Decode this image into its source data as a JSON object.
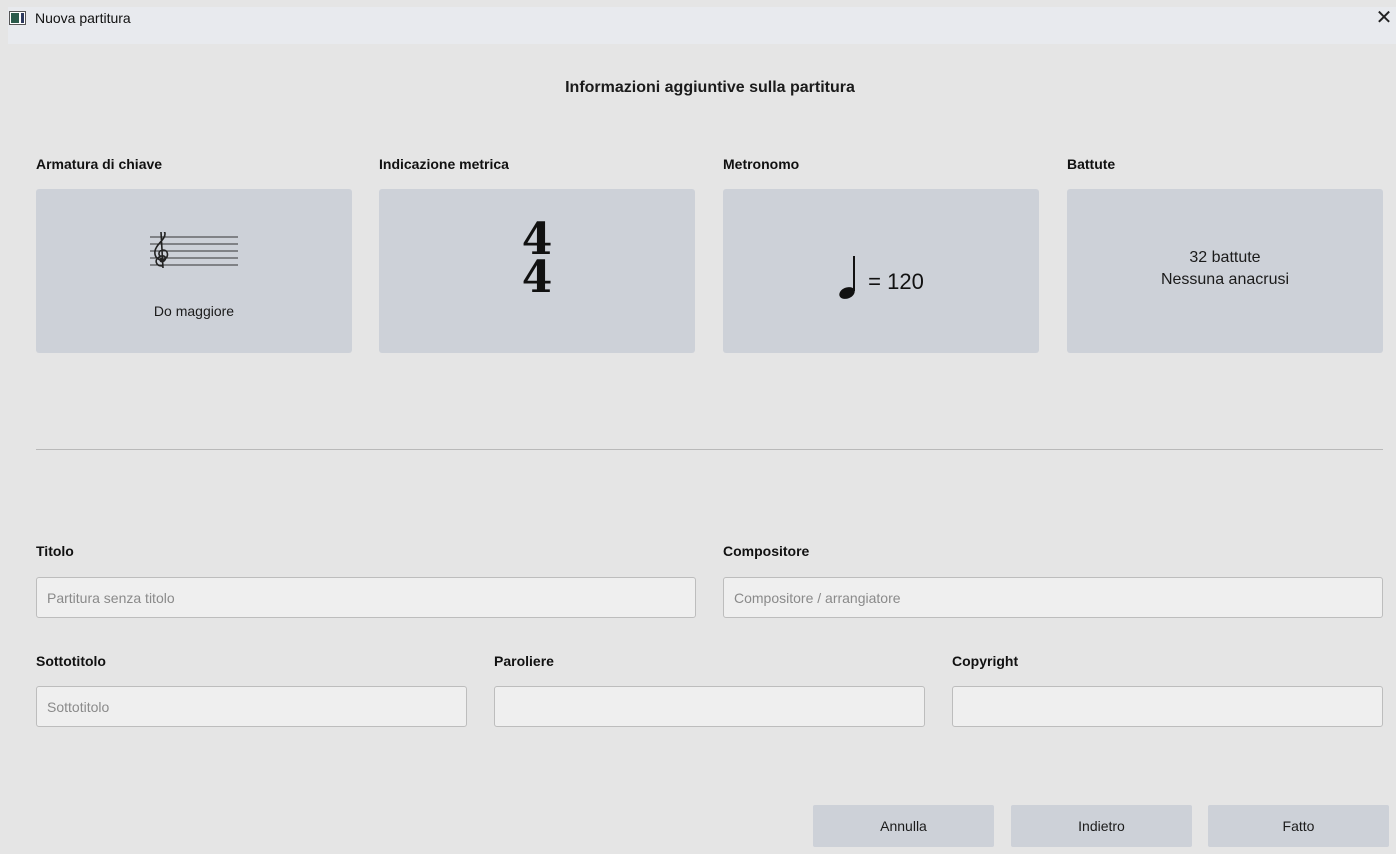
{
  "window": {
    "title": "Nuova partitura",
    "close_glyph": "✕"
  },
  "heading": "Informazioni aggiuntive sulla partitura",
  "sections": {
    "key_signature": {
      "label": "Armatura di chiave",
      "value": "Do maggiore"
    },
    "time_signature": {
      "label": "Indicazione metrica",
      "numerator": "4",
      "denominator": "4"
    },
    "metronome": {
      "label": "Metronomo",
      "value": "= 120"
    },
    "measures": {
      "label": "Battute",
      "count": "32 battute",
      "pickup": "Nessuna anacrusi"
    }
  },
  "fields": {
    "title": {
      "label": "Titolo",
      "placeholder": "Partitura senza titolo",
      "value": ""
    },
    "composer": {
      "label": "Compositore",
      "placeholder": "Compositore / arrangiatore",
      "value": ""
    },
    "subtitle": {
      "label": "Sottotitolo",
      "placeholder": "Sottotitolo",
      "value": ""
    },
    "lyricist": {
      "label": "Paroliere",
      "placeholder": "",
      "value": ""
    },
    "copyright": {
      "label": "Copyright",
      "placeholder": "",
      "value": ""
    }
  },
  "buttons": {
    "cancel": "Annulla",
    "back": "Indietro",
    "done": "Fatto"
  },
  "icons": {
    "app": "musescore-app-icon",
    "close": "close-icon",
    "treble_clef": "treble-clef-icon",
    "quarter_note": "quarter-note-icon"
  },
  "colors": {
    "background": "#e5e5e5",
    "titlebar": "#e8eaee",
    "card": "#cdd1d8",
    "field": "#efefef",
    "button": "#cdd1d8"
  }
}
